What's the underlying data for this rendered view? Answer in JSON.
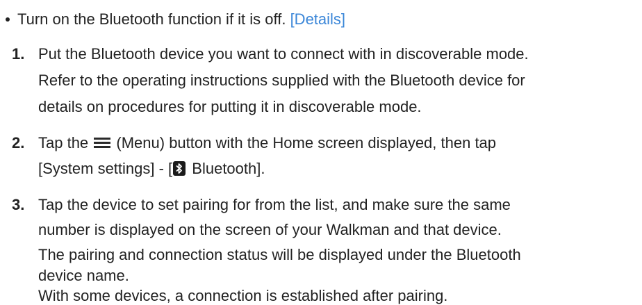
{
  "bullet": {
    "text": "Turn on the Bluetooth function if it is off. ",
    "link": "[Details]"
  },
  "steps": [
    {
      "number": "1.",
      "lines": [
        "Put the Bluetooth device you want to connect with in discoverable mode.",
        "Refer to the operating instructions supplied with the Bluetooth device for",
        "details on procedures for putting it in discoverable mode."
      ]
    },
    {
      "number": "2.",
      "line1_before": "Tap the ",
      "menu_icon": "menu-icon",
      "line1_after": " (Menu) button with the Home screen displayed, then tap",
      "line2_before": "[System settings] - [",
      "bluetooth_icon": "bluetooth-icon",
      "line2_after": " Bluetooth]."
    },
    {
      "number": "3.",
      "lines": [
        "Tap the device to set pairing for from the list, and make sure the same",
        "number is displayed on the screen of your Walkman and that device.",
        "The pairing and connection status will be displayed under the Bluetooth",
        "device name.",
        "With some devices, a connection is established after pairing."
      ]
    }
  ],
  "colors": {
    "text": "#222222",
    "link": "#3a86d8"
  }
}
